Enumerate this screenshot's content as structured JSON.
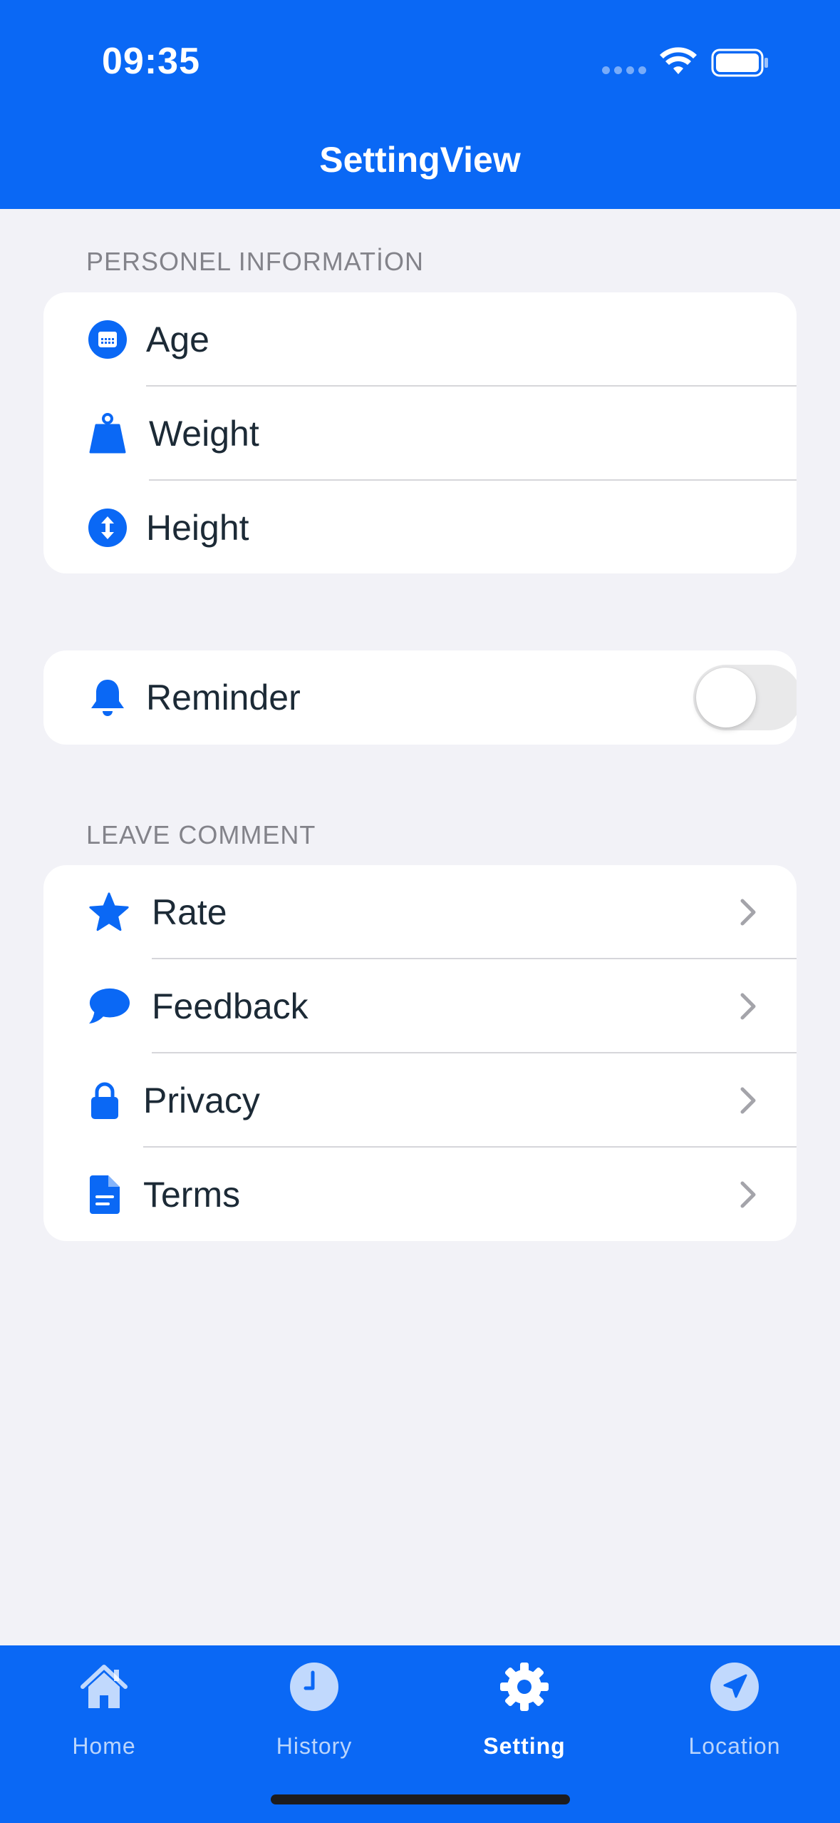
{
  "status_bar": {
    "time": "09:35"
  },
  "nav": {
    "title": "SettingView"
  },
  "sections": {
    "personal": {
      "header": "PERSONEL INFORMATİON",
      "items": [
        {
          "label": "Age",
          "icon": "calendar-icon"
        },
        {
          "label": "Weight",
          "icon": "weight-icon"
        },
        {
          "label": "Height",
          "icon": "height-icon"
        }
      ]
    },
    "reminder": {
      "label": "Reminder",
      "icon": "bell-icon",
      "toggle_on": false
    },
    "comment": {
      "header": "LEAVE COMMENT",
      "items": [
        {
          "label": "Rate",
          "icon": "star-icon"
        },
        {
          "label": "Feedback",
          "icon": "speech-bubble-icon"
        },
        {
          "label": "Privacy",
          "icon": "lock-icon"
        },
        {
          "label": "Terms",
          "icon": "document-icon"
        }
      ]
    }
  },
  "tabbar": {
    "tabs": [
      {
        "label": "Home",
        "icon": "house-icon",
        "active": false
      },
      {
        "label": "History",
        "icon": "clock-icon",
        "active": false
      },
      {
        "label": "Setting",
        "icon": "gear-icon",
        "active": true
      },
      {
        "label": "Location",
        "icon": "location-arrow-icon",
        "active": false
      }
    ]
  },
  "colors": {
    "accent": "#0a68f5",
    "background": "#f2f2f7",
    "text": "#1c2a36",
    "secondary_text": "#83838a"
  }
}
